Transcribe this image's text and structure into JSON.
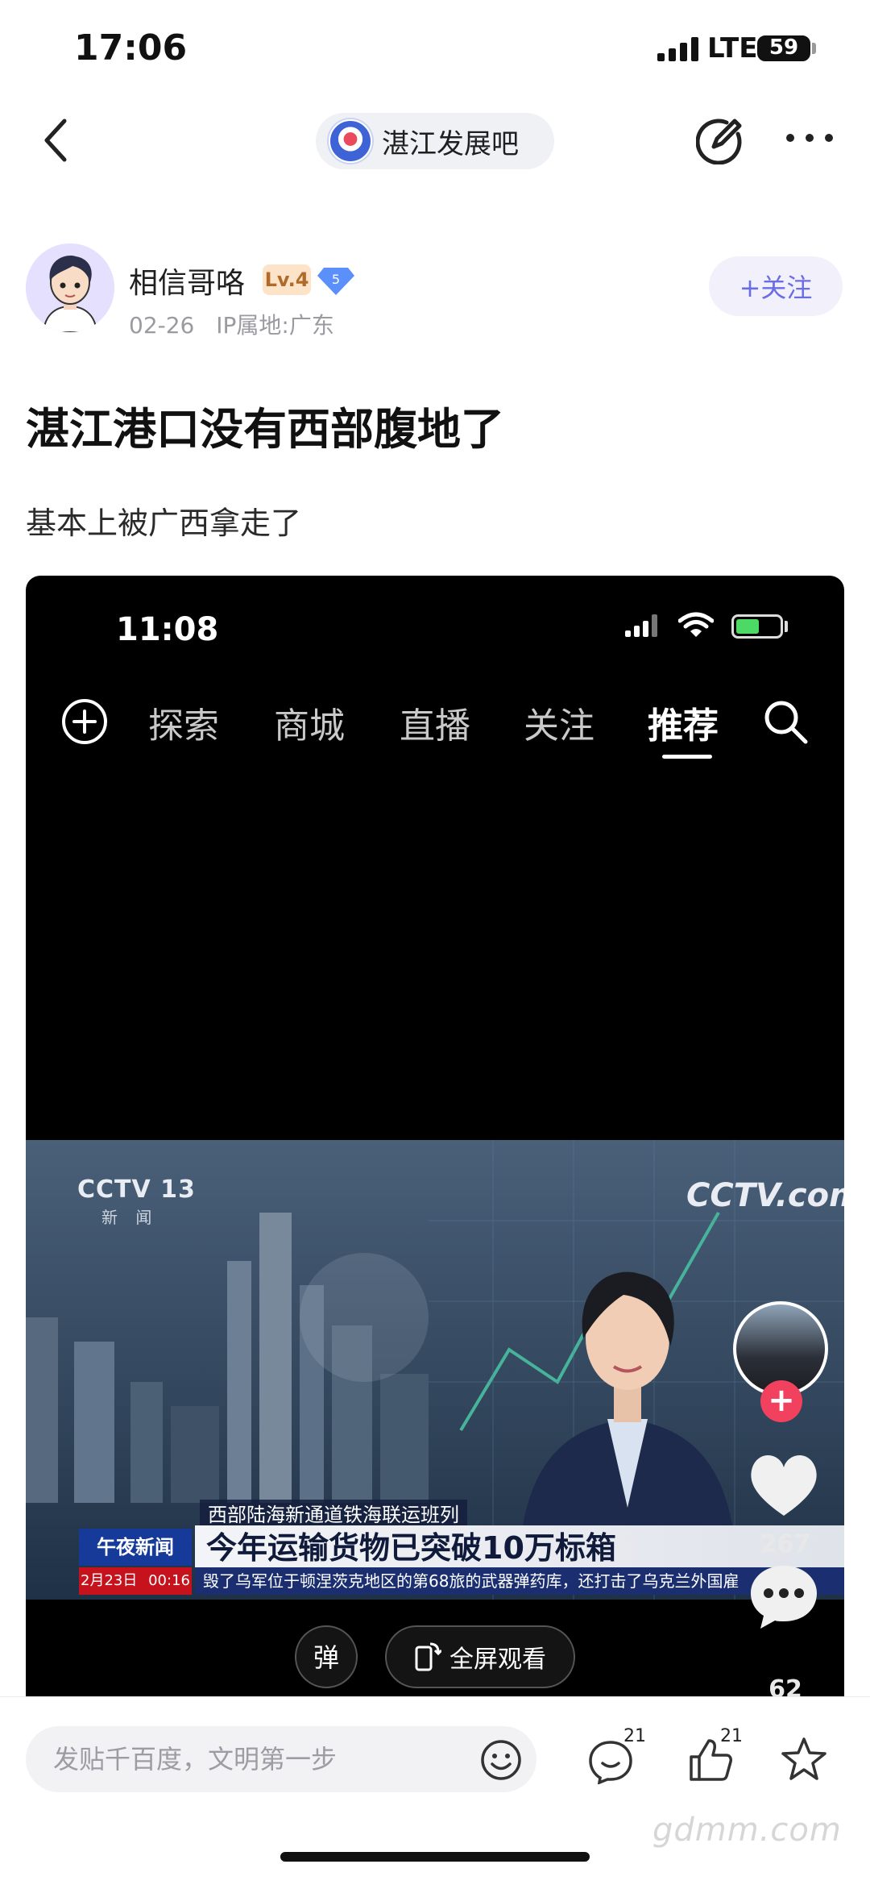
{
  "status_bar": {
    "time": "17:06",
    "network": "LTE",
    "battery": "59"
  },
  "nav": {
    "forum_name": "湛江发展吧"
  },
  "author": {
    "name": "相信哥咯",
    "level": "Lv.4",
    "vip_level": "5",
    "date": "02-26",
    "ip_location": "IP属地:广东",
    "follow_label": "+关注"
  },
  "post": {
    "title": "湛江港口没有西部腹地了",
    "body": "基本上被广西拿走了"
  },
  "embedded_screenshot": {
    "time": "11:08",
    "tabs": [
      {
        "label": "探索",
        "active": false
      },
      {
        "label": "商城",
        "active": false
      },
      {
        "label": "直播",
        "active": false
      },
      {
        "label": "关注",
        "active": false
      },
      {
        "label": "推荐",
        "active": true
      }
    ],
    "video": {
      "channel_logo": "CCTV 13",
      "channel_sub": "新 闻",
      "site_logo": "CCTV.com",
      "program": "午夜新闻",
      "headline_small": "西部陆海新通道铁海联运班列",
      "headline": "今年运输货物已突破10万标箱",
      "date": "2月23日",
      "clock": "00:16",
      "ticker": "毁了乌军位于顿涅茨克地区的第68旅的武器弹药库，还打击了乌克兰外国雇"
    },
    "likes": "267",
    "comments": "62",
    "danmaku_label": "弹",
    "fullscreen_label": "全屏观看"
  },
  "bottom_bar": {
    "reply_placeholder": "发贴千百度，文明第一步",
    "reply_count": "21",
    "like_count": "21"
  },
  "watermark": "gdmm.com",
  "colors": {
    "accent": "#6b6de6",
    "level_badge_bg": "#fde3c8",
    "vip_blue": "#5b8ff9",
    "live_red": "#f2405f"
  }
}
